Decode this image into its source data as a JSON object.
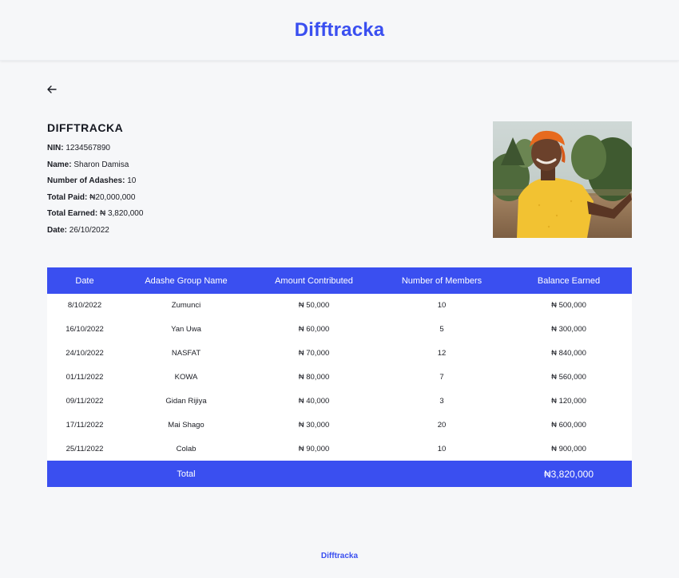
{
  "header": {
    "brand": "Difftracka"
  },
  "nav": {
    "back_icon": "arrow-left-icon"
  },
  "profile": {
    "title": "DIFFTRACKA",
    "fields": [
      {
        "label": "NIN:",
        "value": "1234567890"
      },
      {
        "label": "Name:",
        "value": "Sharon Damisa"
      },
      {
        "label": "Number of Adashes:",
        "value": "10"
      },
      {
        "label": "Total Paid:",
        "value": "₦20,000,000"
      },
      {
        "label": "Total Earned:",
        "value": "₦ 3,820,000"
      },
      {
        "label": "Date:",
        "value": "26/10/2022"
      }
    ]
  },
  "table": {
    "headers": [
      "Date",
      "Adashe Group Name",
      "Amount Contributed",
      "Number of Members",
      "Balance Earned"
    ],
    "rows": [
      [
        "8/10/2022",
        "Zumunci",
        "₦ 50,000",
        "10",
        "₦ 500,000"
      ],
      [
        "16/10/2022",
        "Yan Uwa",
        "₦ 60,000",
        "5",
        "₦ 300,000"
      ],
      [
        "24/10/2022",
        "NASFAT",
        "₦ 70,000",
        "12",
        "₦ 840,000"
      ],
      [
        "01/11/2022",
        "KOWA",
        "₦ 80,000",
        "7",
        "₦ 560,000"
      ],
      [
        "09/11/2022",
        "Gidan Rijiya",
        "₦ 40,000",
        "3",
        "₦ 120,000"
      ],
      [
        "17/11/2022",
        "Mai Shago",
        "₦ 30,000",
        "20",
        "₦ 600,000"
      ],
      [
        "25/11/2022",
        "Colab",
        "₦ 90,000",
        "10",
        "₦ 900,000"
      ]
    ],
    "footer": {
      "label": "Total",
      "value": "₦3,820,000"
    }
  },
  "footer": {
    "brand": "Difftracka"
  },
  "colors": {
    "accent": "#3a4ff0",
    "background": "#f6f7f9",
    "table_bg": "#ffffff"
  }
}
